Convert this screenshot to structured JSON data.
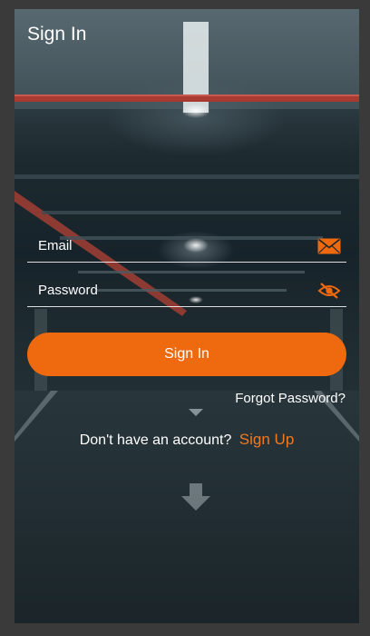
{
  "header": {
    "title": "Sign In"
  },
  "form": {
    "email_placeholder": "Email",
    "password_placeholder": "Password",
    "submit_label": "Sign In",
    "forgot_label": "Forgot Password?"
  },
  "signup": {
    "prompt": "Don't have an account?",
    "link_label": "Sign Up"
  },
  "icons": {
    "email": "envelope-icon",
    "password": "eye-off-icon"
  },
  "colors": {
    "accent": "#ef6a0f",
    "link": "#f07a22",
    "text": "#ffffff"
  }
}
